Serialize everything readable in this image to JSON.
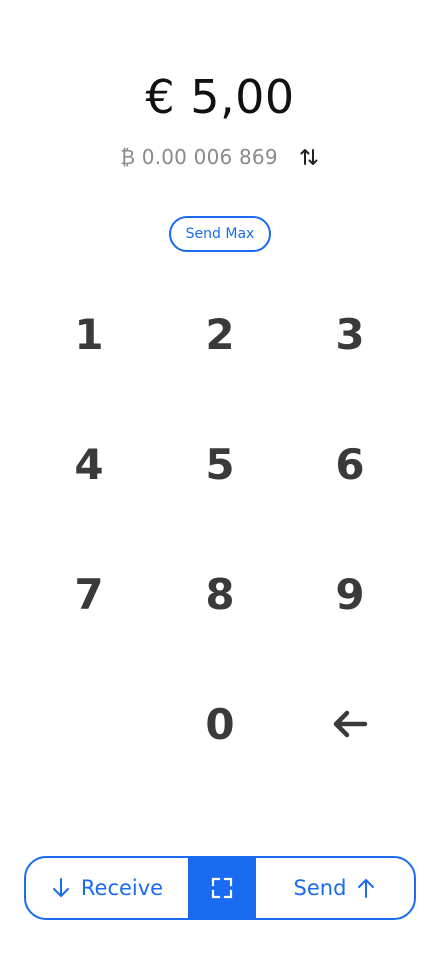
{
  "amount": {
    "fiat": "€ 5,00",
    "btc": "₿ 0.00 006 869"
  },
  "send_max_label": "Send Max",
  "keypad": {
    "keys": [
      "1",
      "2",
      "3",
      "4",
      "5",
      "6",
      "7",
      "8",
      "9",
      "0"
    ],
    "backspace_icon": "arrow-left-icon"
  },
  "bottom_bar": {
    "receive_label": "Receive",
    "send_label": "Send",
    "receive_icon": "arrow-down-icon",
    "scan_icon": "scan-icon",
    "send_icon": "arrow-up-icon"
  },
  "colors": {
    "accent": "#1a6bf0",
    "key_text": "#3a3a3a",
    "secondary_text": "#8a8a8a"
  }
}
